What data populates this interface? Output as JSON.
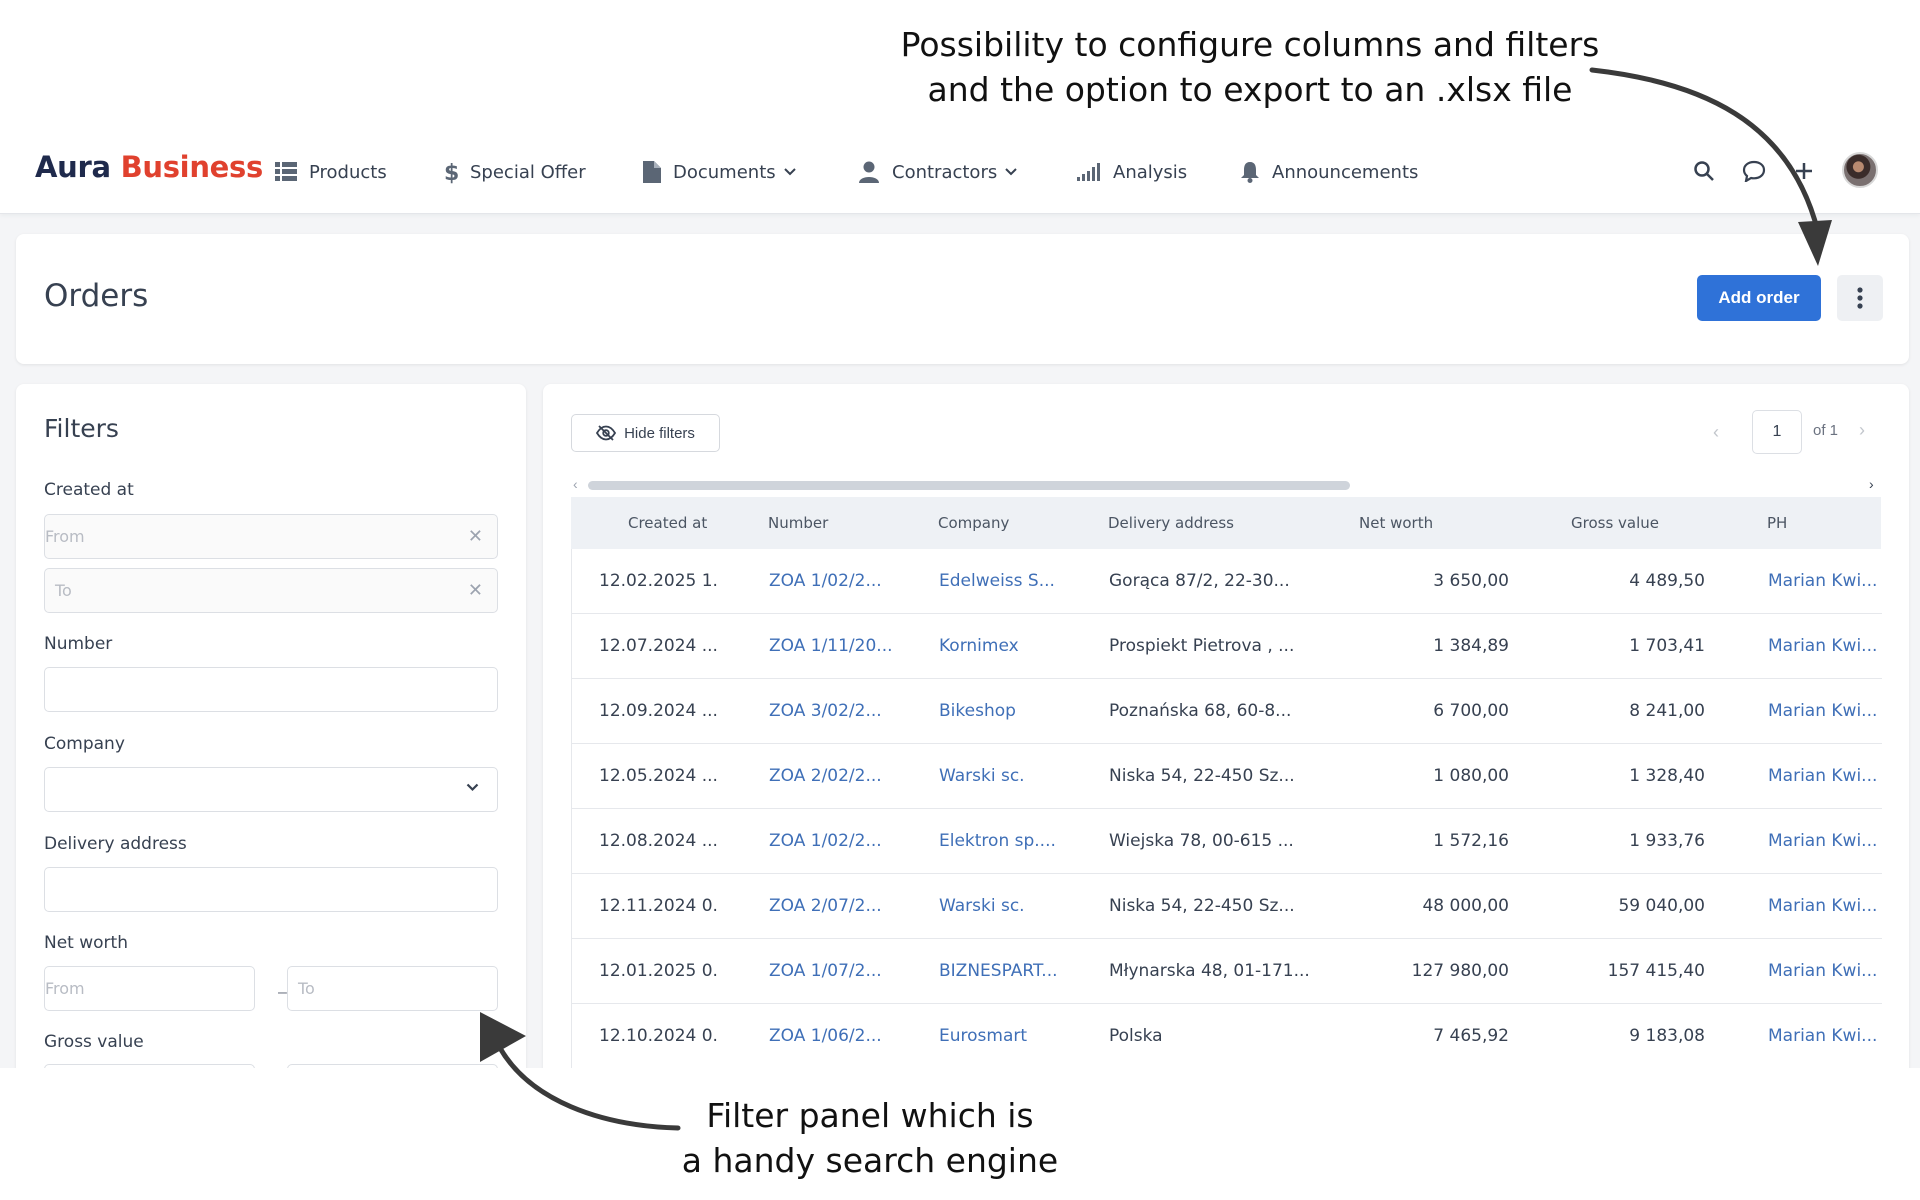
{
  "captions": {
    "top": [
      "Possibility to configure columns and filters",
      "and the option to export to an .xlsx file"
    ],
    "bottom": [
      "Filter panel which is",
      "a handy search engine"
    ]
  },
  "navbar": {
    "logo_part1": "Aura",
    "logo_part2": "Business",
    "items": [
      {
        "label": "Products",
        "icon": "grid-list-icon"
      },
      {
        "label": "Special Offer",
        "icon": "dollar-icon"
      },
      {
        "label": "Documents",
        "icon": "document-icon",
        "dropdown": true
      },
      {
        "label": "Contractors",
        "icon": "person-icon",
        "dropdown": true
      },
      {
        "label": "Analysis",
        "icon": "signal-bars-icon"
      },
      {
        "label": "Announcements",
        "icon": "bell-icon"
      }
    ],
    "actions": [
      "search-icon",
      "chat-icon",
      "plus-icon",
      "avatar"
    ]
  },
  "page": {
    "title": "Orders",
    "add_button": "Add order"
  },
  "filters": {
    "title": "Filters",
    "created_at": {
      "label": "Created at",
      "from_placeholder": "From",
      "to_placeholder": "To"
    },
    "number": {
      "label": "Number",
      "value": ""
    },
    "company": {
      "label": "Company",
      "value": ""
    },
    "delivery_address": {
      "label": "Delivery address",
      "value": ""
    },
    "net_worth": {
      "label": "Net worth",
      "from_placeholder": "From",
      "to_placeholder": "To",
      "separator": "–"
    },
    "gross_value": {
      "label": "Gross value"
    }
  },
  "table": {
    "hide_filters": "Hide filters",
    "pager": {
      "current": "1",
      "of_label": "of 1"
    },
    "columns": [
      "Created at",
      "Number",
      "Company",
      "Delivery address",
      "Net worth",
      "Gross value",
      "PH"
    ],
    "rows": [
      [
        "12.02.2025 1...",
        "ZOA 1/02/2...",
        "Edelweiss S...",
        "Gorąca 87/2, 22-30...",
        "3 650,00",
        "4 489,50",
        "Marian Kwi..."
      ],
      [
        "12.07.2024 ...",
        "ZOA 1/11/20...",
        "Kornimex",
        "Prospiekt Pietrova , ...",
        "1 384,89",
        "1 703,41",
        "Marian Kwi..."
      ],
      [
        "12.09.2024 ...",
        "ZOA 3/02/2...",
        "Bikeshop",
        "Poznańska 68, 60-8...",
        "6 700,00",
        "8 241,00",
        "Marian Kwi..."
      ],
      [
        "12.05.2024 ...",
        "ZOA 2/02/2...",
        "Warski sc.",
        "Niska 54, 22-450 Sz...",
        "1 080,00",
        "1 328,40",
        "Marian Kwi..."
      ],
      [
        "12.08.2024 ...",
        "ZOA 1/02/2...",
        "Elektron sp....",
        "Wiejska 78, 00-615 ...",
        "1 572,16",
        "1 933,76",
        "Marian Kwi..."
      ],
      [
        "12.11.2024 0...",
        "ZOA 2/07/2...",
        "Warski sc.",
        "Niska 54, 22-450 Sz...",
        "48 000,00",
        "59 040,00",
        "Marian Kwi..."
      ],
      [
        "12.01.2025 0...",
        "ZOA 1/07/2...",
        "BIZNESPART...",
        "Młynarska 48, 01-171...",
        "127 980,00",
        "157 415,40",
        "Marian Kwi..."
      ],
      [
        "12.10.2024 0...",
        "ZOA 1/06/2...",
        "Eurosmart",
        "Polska",
        "7 465,92",
        "9 183,08",
        "Marian Kwi..."
      ]
    ]
  },
  "colors": {
    "brand_dark": "#1f2a4c",
    "brand_red": "#e0412e",
    "primary_button": "#2f72d8",
    "link": "#3f6fb7"
  }
}
